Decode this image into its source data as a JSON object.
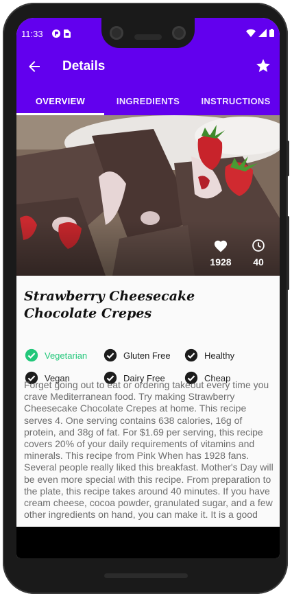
{
  "status_bar": {
    "time": "11:33",
    "left_icons": [
      "app-notification-icon",
      "sim-card-icon"
    ],
    "right_icons": [
      "wifi-icon",
      "signal-icon",
      "battery-icon"
    ]
  },
  "app_bar": {
    "title": "Details",
    "back_icon": "arrow-back-icon",
    "favorite_icon": "star-icon"
  },
  "tabs": [
    {
      "label": "OVERVIEW",
      "active": true
    },
    {
      "label": "INGREDIENTS",
      "active": false
    },
    {
      "label": "INSTRUCTIONS",
      "active": false
    }
  ],
  "hero": {
    "likes": {
      "icon": "heart-icon",
      "value": "1928"
    },
    "time": {
      "icon": "clock-icon",
      "value": "40"
    }
  },
  "recipe": {
    "title": "Strawberry Cheesecake Chocolate Crepes",
    "tags": [
      {
        "label": "Vegetarian",
        "active": true
      },
      {
        "label": "Gluten Free",
        "active": false
      },
      {
        "label": "Healthy",
        "active": false
      },
      {
        "label": "Vegan",
        "active": false
      },
      {
        "label": "Dairy Free",
        "active": false
      },
      {
        "label": "Cheap",
        "active": false
      }
    ],
    "summary": "Forget going out to eat or ordering takeout every time you crave Mediterranean food. Try making Strawberry Cheesecake Chocolate Crepes at home. This recipe serves 4. One serving contains 638 calories, 16g of protein, and 38g of fat. For $1.69 per serving, this recipe covers 20% of your daily requirements of vitamins and minerals. This recipe from Pink When has 1928 fans. Several people really liked this breakfast. Mother's Day will be even more special with this recipe. From preparation to the plate, this recipe takes around 40 minutes. If you have cream cheese, cocoa powder, granulated sugar, and a few other ingredients on hand, you can make it. It is a good"
  },
  "colors": {
    "primary": "#6200ee",
    "accent_green": "#22c77a",
    "text_dark": "#111111",
    "text_muted": "#6e6e6e"
  }
}
